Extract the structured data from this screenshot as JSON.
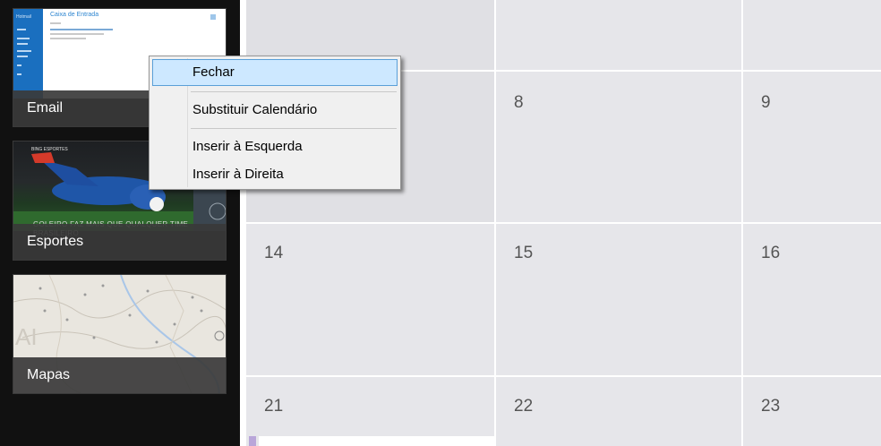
{
  "sidebar": {
    "apps": [
      {
        "label": "Email",
        "preview": {
          "header": "Caixa de Entrada",
          "nav_title": "Hotmail"
        }
      },
      {
        "label": "Esportes",
        "preview": {
          "header": "BING ESPORTES",
          "caption": "GOLEIRO FAZ MAIS QUE QUALQUER TIME BRASILEIRO"
        }
      },
      {
        "label": "Mapas"
      }
    ]
  },
  "context_menu": {
    "items": [
      {
        "label": "Fechar",
        "highlighted": true
      },
      {
        "label": "Substituir Calendário"
      },
      {
        "label": "Inserir à Esquerda"
      },
      {
        "label": "Inserir à Direita"
      }
    ]
  },
  "calendar": {
    "rows": [
      [
        "",
        "",
        ""
      ],
      [
        "",
        "8",
        "9"
      ],
      [
        "14",
        "15",
        "16"
      ],
      [
        "21",
        "22",
        "23"
      ]
    ]
  },
  "colors": {
    "menu_highlight": "#cde8ff",
    "menu_highlight_border": "#5a9fd8",
    "calendar_cell": "#e6e6ea",
    "sidebar_bg": "#111111",
    "mail_accent": "#1a6fbf"
  }
}
